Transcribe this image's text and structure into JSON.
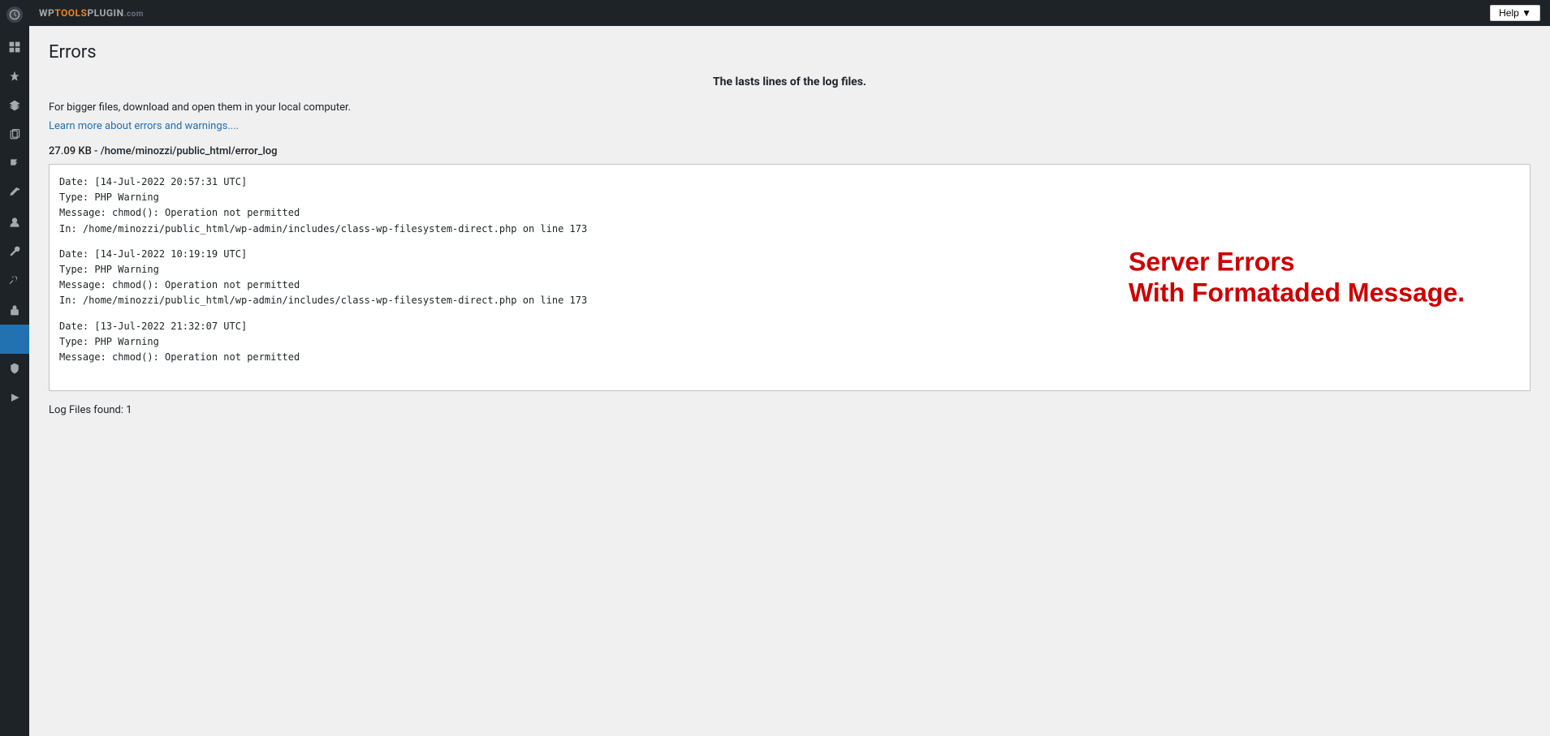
{
  "topbar": {
    "brand": {
      "wp": "WP",
      "tools": "TOOLS",
      "plugin": "PLUGIN",
      "com": ".com"
    },
    "help_label": "Help ▼"
  },
  "sidebar": {
    "icons": [
      {
        "name": "dashboard-icon",
        "symbol": "⊞",
        "active": false
      },
      {
        "name": "pin-icon",
        "symbol": "📌",
        "active": false
      },
      {
        "name": "layers-icon",
        "symbol": "⚙",
        "active": false
      },
      {
        "name": "copy-icon",
        "symbol": "❏",
        "active": false
      },
      {
        "name": "flag-icon",
        "symbol": "⚑",
        "active": false
      },
      {
        "name": "edit-icon",
        "symbol": "✏",
        "active": false
      },
      {
        "name": "user-icon",
        "symbol": "👤",
        "active": false
      },
      {
        "name": "wrench-icon",
        "symbol": "🔧",
        "active": false
      },
      {
        "name": "tools-icon",
        "symbol": "⚒",
        "active": false
      },
      {
        "name": "lock-icon",
        "symbol": "🔒",
        "active": false
      },
      {
        "name": "tools2-icon",
        "symbol": "✕",
        "active": true
      },
      {
        "name": "shield-icon",
        "symbol": "🔐",
        "active": false
      },
      {
        "name": "play-icon",
        "symbol": "▶",
        "active": false
      }
    ]
  },
  "page": {
    "title": "Errors",
    "subtitle": "The lasts lines of the log files.",
    "description": "For bigger files, download and open them in your local computer.",
    "learn_more_link": "Learn more about errors and warnings....",
    "file_info": "27.09 KB - /home/minozzi/public_html/error_log",
    "log_entries": [
      {
        "date": "Date:  [14-Jul-2022 20:57:31 UTC]",
        "type": "Type:  PHP Warning",
        "message": "Message: chmod(): Operation not permitted",
        "location": "In: /home/minozzi/public_html/wp-admin/includes/class-wp-filesystem-direct.php on line 173"
      },
      {
        "date": "Date:  [14-Jul-2022 10:19:19 UTC]",
        "type": "Type:  PHP Warning",
        "message": "Message: chmod(): Operation not permitted",
        "location": "In: /home/minozzi/public_html/wp-admin/includes/class-wp-filesystem-direct.php on line 173"
      },
      {
        "date": "Date:  [13-Jul-2022 21:32:07 UTC]",
        "type": "Type:  PHP Warning",
        "message": "Message: chmod(): Operation not permitted",
        "location": ""
      }
    ],
    "overlay_line1": "Server Errors",
    "overlay_line2": "With Formataded Message.",
    "log_files_found": "Log Files found: 1"
  }
}
